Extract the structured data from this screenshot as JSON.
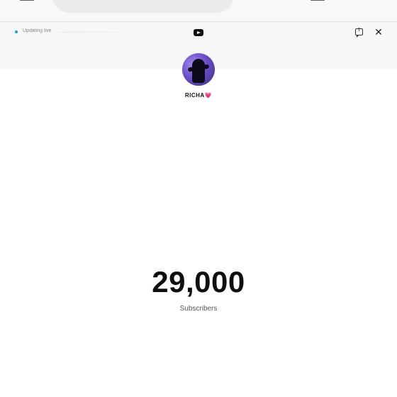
{
  "status": {
    "live_text": "Updating live",
    "live_color": "#1a9fd8"
  },
  "channel": {
    "name": "RICHA",
    "name_emoji": "💗"
  },
  "stats": {
    "subscriber_count": "29,000",
    "subscriber_label": "Subscribers"
  },
  "icons": {
    "menu": "menu-icon",
    "logo": "youtube-logo-icon",
    "feedback": "feedback-icon",
    "close": "close-icon",
    "close_glyph": "✕"
  }
}
